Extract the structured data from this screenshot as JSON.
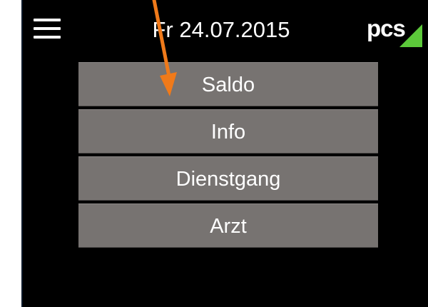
{
  "header": {
    "menu_icon": "hamburger-menu-icon",
    "date": "Fr 24.07.2015",
    "logo_text": "pcs",
    "logo_mark": "green-triangle-logo-icon"
  },
  "menu": {
    "items": [
      {
        "label": "Saldo"
      },
      {
        "label": "Info"
      },
      {
        "label": "Dienstgang"
      },
      {
        "label": "Arzt"
      }
    ]
  },
  "annotation": {
    "arrow_icon": "orange-annotation-arrow",
    "color": "#f07a1a"
  },
  "colors": {
    "background": "#000000",
    "button": "#777371",
    "text": "#ffffff",
    "logo_accent": "#5cc93a",
    "annotation": "#f07a1a"
  }
}
